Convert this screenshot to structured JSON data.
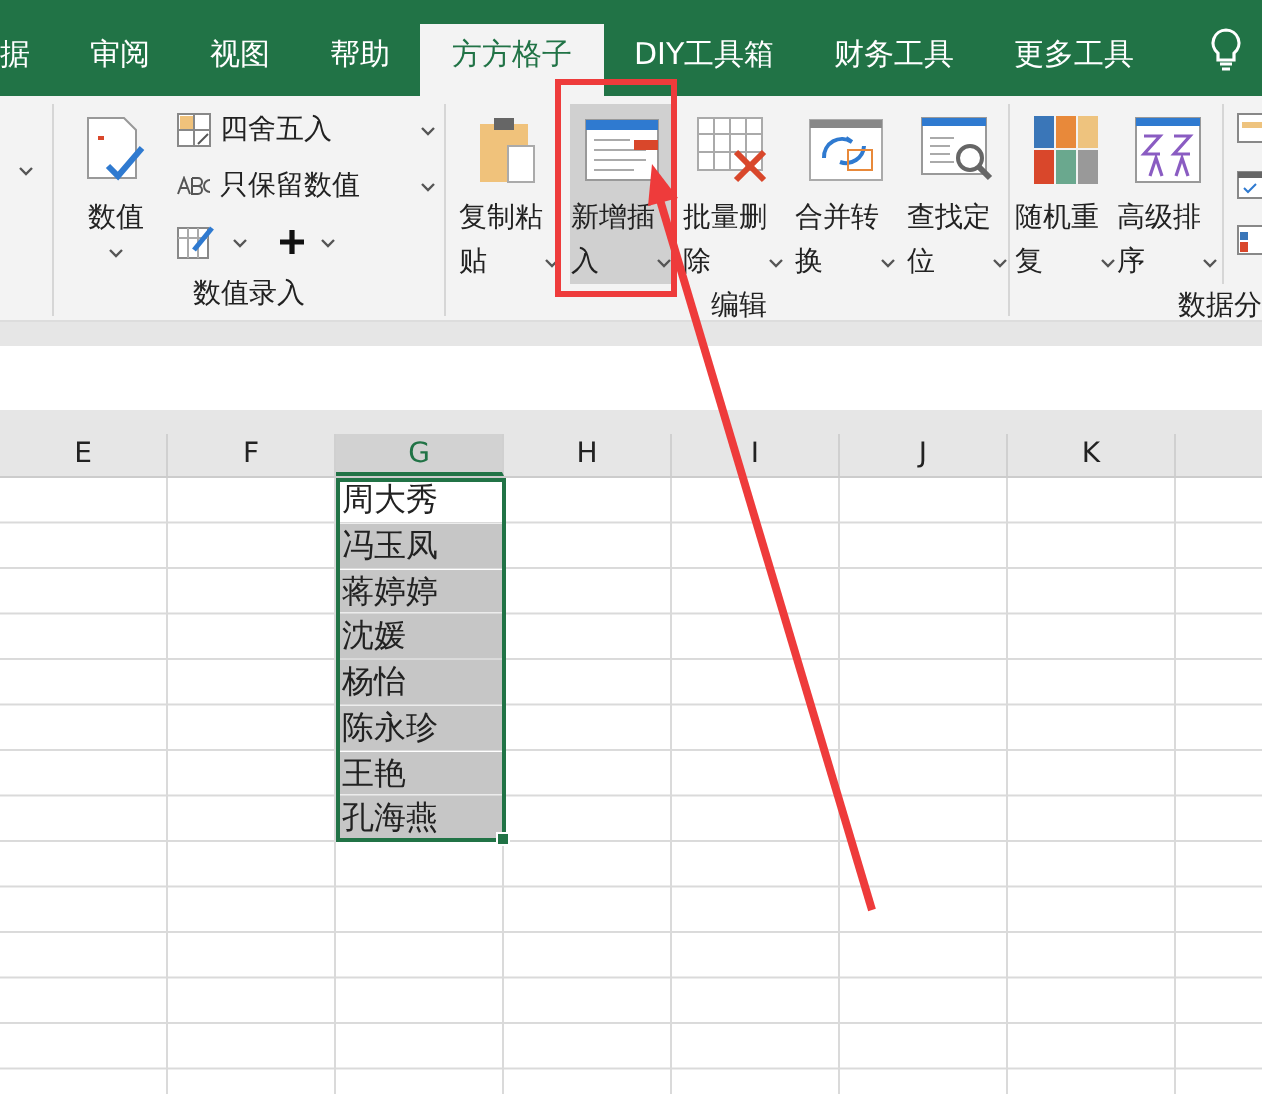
{
  "tabs": [
    {
      "label": "据",
      "selected": false
    },
    {
      "label": "审阅",
      "selected": false
    },
    {
      "label": "视图",
      "selected": false
    },
    {
      "label": "帮助",
      "selected": false
    },
    {
      "label": "方方格子",
      "selected": true
    },
    {
      "label": "DIY工具箱",
      "selected": false
    },
    {
      "label": "财务工具",
      "selected": false
    },
    {
      "label": "更多工具",
      "selected": false
    }
  ],
  "ribbon": {
    "groups": [
      {
        "label": "数值录入",
        "big_buttons": [
          {
            "label": "数值",
            "highlighted": false
          }
        ],
        "small_buttons": [
          {
            "label": "四舍五入"
          },
          {
            "label": "只保留数值"
          }
        ]
      },
      {
        "label": "编辑",
        "big_buttons": [
          {
            "label": "复制粘贴",
            "highlighted": false
          },
          {
            "label": "新增插入",
            "highlighted": true
          },
          {
            "label": "批量删除",
            "highlighted": false
          },
          {
            "label": "合并转换",
            "highlighted": false
          },
          {
            "label": "查找定位",
            "highlighted": false
          }
        ]
      },
      {
        "label": "数据分",
        "big_buttons": [
          {
            "label": "随机重复",
            "highlighted": false
          },
          {
            "label": "高级排序",
            "highlighted": false
          }
        ]
      }
    ]
  },
  "sheet": {
    "columns": [
      {
        "label": "E",
        "selected": false
      },
      {
        "label": "F",
        "selected": false
      },
      {
        "label": "G",
        "selected": true
      },
      {
        "label": "H",
        "selected": false
      },
      {
        "label": "I",
        "selected": false
      },
      {
        "label": "J",
        "selected": false
      },
      {
        "label": "K",
        "selected": false
      }
    ],
    "cells": [
      {
        "text": "周大秀",
        "active": true
      },
      {
        "text": "冯玉凤",
        "active": false
      },
      {
        "text": "蒋婷婷",
        "active": false
      },
      {
        "text": "沈媛",
        "active": false
      },
      {
        "text": "杨怡",
        "active": false
      },
      {
        "text": "陈永珍",
        "active": false
      },
      {
        "text": "王艳",
        "active": false
      },
      {
        "text": "孔海燕",
        "active": false
      }
    ]
  }
}
